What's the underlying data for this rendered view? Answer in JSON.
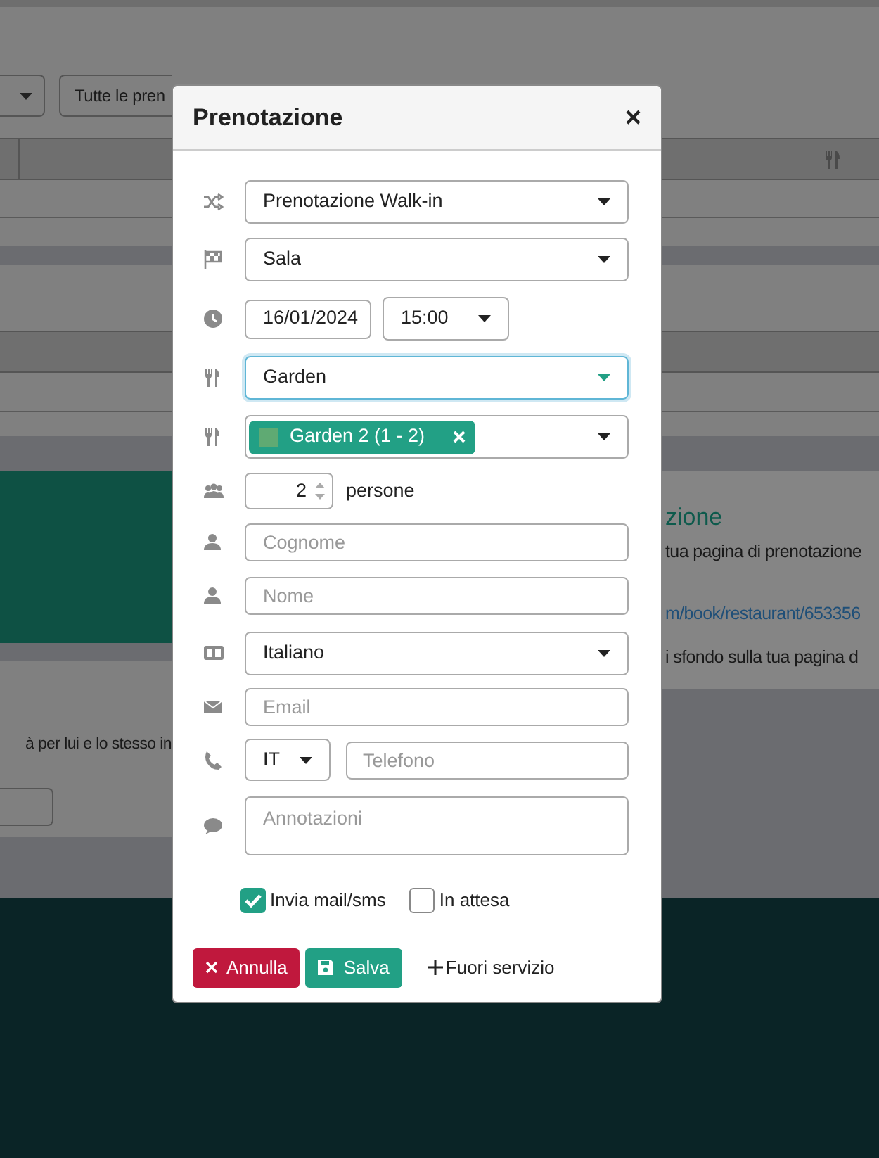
{
  "background": {
    "filter_button": "Tutte le pren",
    "info_title": "zione",
    "info_text": "tua pagina di prenotazione",
    "info_link": "m/book/restaurant/653356",
    "info_note": "i sfondo sulla tua pagina d",
    "left_text": "à per lui e lo stesso in"
  },
  "modal": {
    "title": "Prenotazione",
    "close": "×",
    "rows": [
      {
        "kind": "select",
        "value": "Prenotazione Walk-in",
        "focused": false
      },
      {
        "kind": "select",
        "value": "Sala",
        "focused": false
      },
      {
        "kind": "datetime",
        "date": "16/01/2024",
        "time": "15:00"
      },
      {
        "kind": "select",
        "value": "Garden",
        "focused": true
      },
      {
        "kind": "tags",
        "tags": [
          "Garden 2 (1 - 2)"
        ]
      },
      {
        "kind": "number",
        "value": "2",
        "suffix": "persone"
      },
      {
        "kind": "input",
        "placeholder": "Cognome"
      },
      {
        "kind": "input",
        "placeholder": "Nome"
      },
      {
        "kind": "select",
        "value": "Italiano",
        "focused": false
      },
      {
        "kind": "input",
        "placeholder": "Email"
      },
      {
        "kind": "phone",
        "country": "IT",
        "placeholder": "Telefono"
      },
      {
        "kind": "textarea",
        "placeholder": "Annotazioni"
      }
    ],
    "checks": [
      {
        "label": "Invia mail/sms",
        "checked": true
      },
      {
        "label": "In attesa",
        "checked": false
      }
    ],
    "buttons": [
      {
        "kind": "danger",
        "label": "Annulla"
      },
      {
        "kind": "primary",
        "label": "Salva"
      },
      {
        "kind": "link",
        "label": "Fuori servizio"
      }
    ]
  }
}
